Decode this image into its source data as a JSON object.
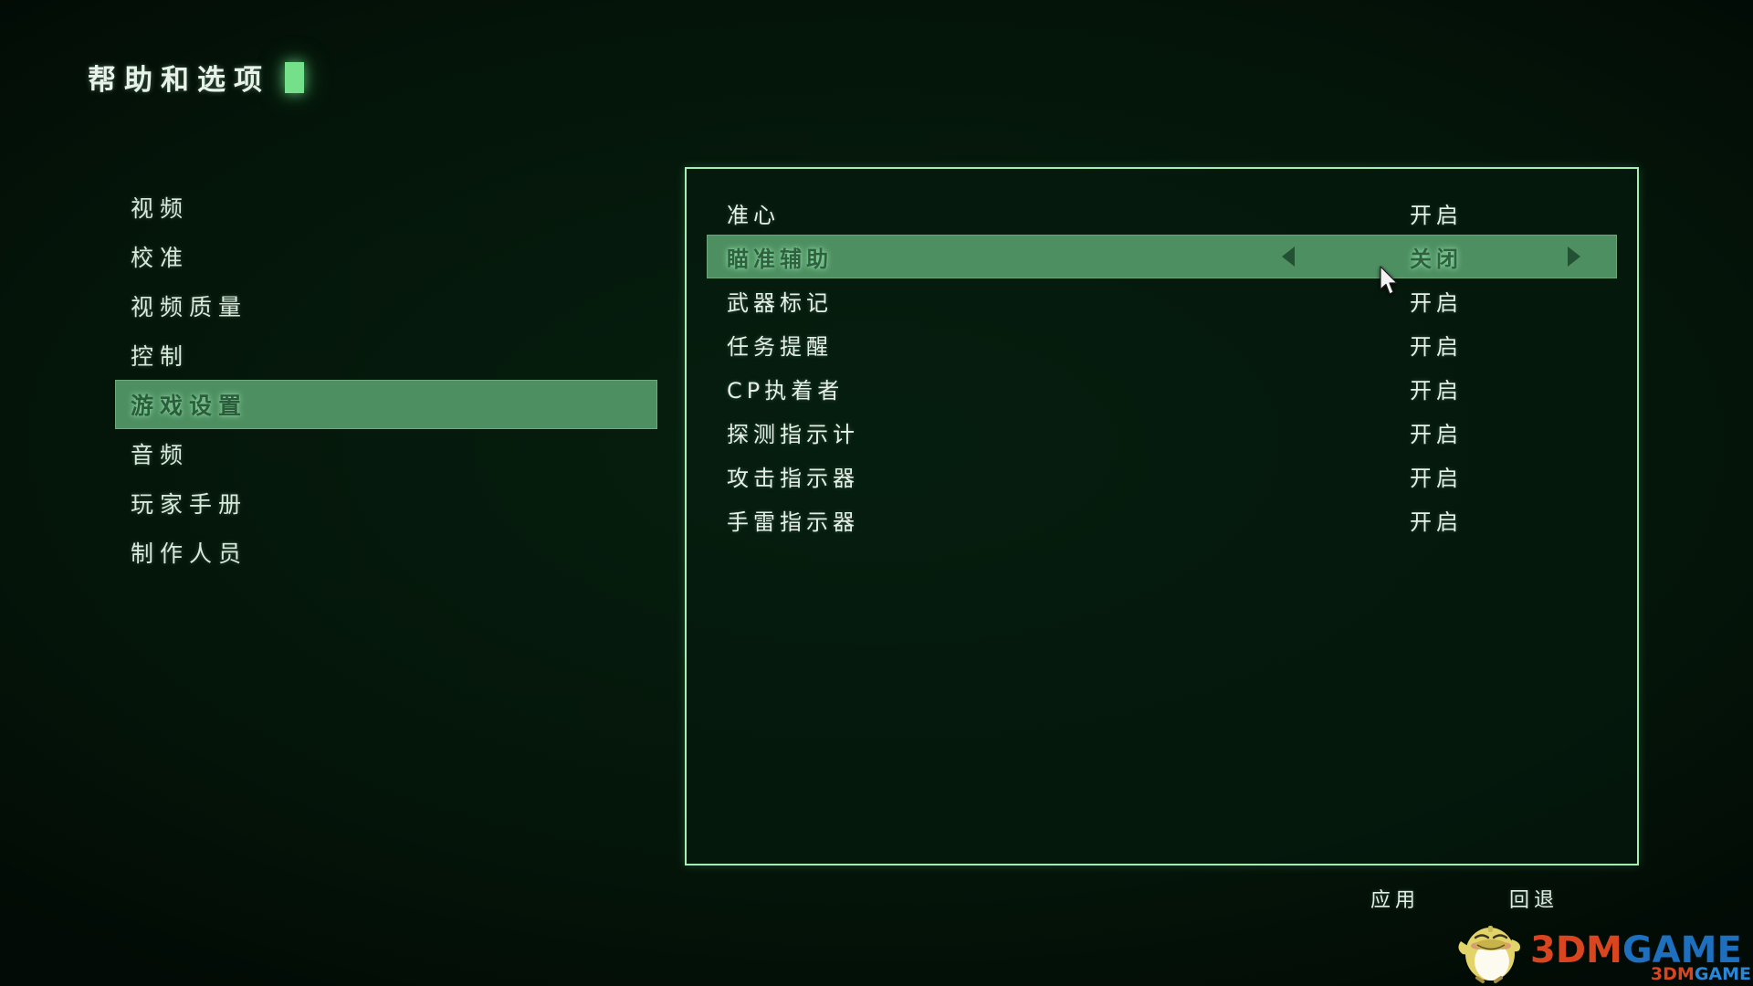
{
  "header": {
    "title": "帮助和选项",
    "caret_color": "#74e08a"
  },
  "sidebar": {
    "items": [
      {
        "label": "视频",
        "active": false
      },
      {
        "label": "校准",
        "active": false
      },
      {
        "label": "视频质量",
        "active": false
      },
      {
        "label": "控制",
        "active": false
      },
      {
        "label": "游戏设置",
        "active": true
      },
      {
        "label": "音频",
        "active": false
      },
      {
        "label": "玩家手册",
        "active": false
      },
      {
        "label": "制作人员",
        "active": false
      }
    ],
    "highlight_color": "#4e8f62"
  },
  "panel": {
    "border_color": "#a4f0b4",
    "options": [
      {
        "label": "准心",
        "value": "开启",
        "selected": false
      },
      {
        "label": "瞄准辅助",
        "value": "关闭",
        "selected": true
      },
      {
        "label": "武器标记",
        "value": "开启",
        "selected": false
      },
      {
        "label": "任务提醒",
        "value": "开启",
        "selected": false
      },
      {
        "label": "CP执着者",
        "value": "开启",
        "selected": false
      },
      {
        "label": "探测指示计",
        "value": "开启",
        "selected": false
      },
      {
        "label": "攻击指示器",
        "value": "开启",
        "selected": false
      },
      {
        "label": "手雷指示器",
        "value": "开启",
        "selected": false
      }
    ]
  },
  "footer": {
    "apply_label": "应用",
    "back_label": "回退"
  },
  "watermark": {
    "text_1": "3DM",
    "text_2": "GAME",
    "sub_1": "3DM",
    "sub_2": "GAME"
  }
}
